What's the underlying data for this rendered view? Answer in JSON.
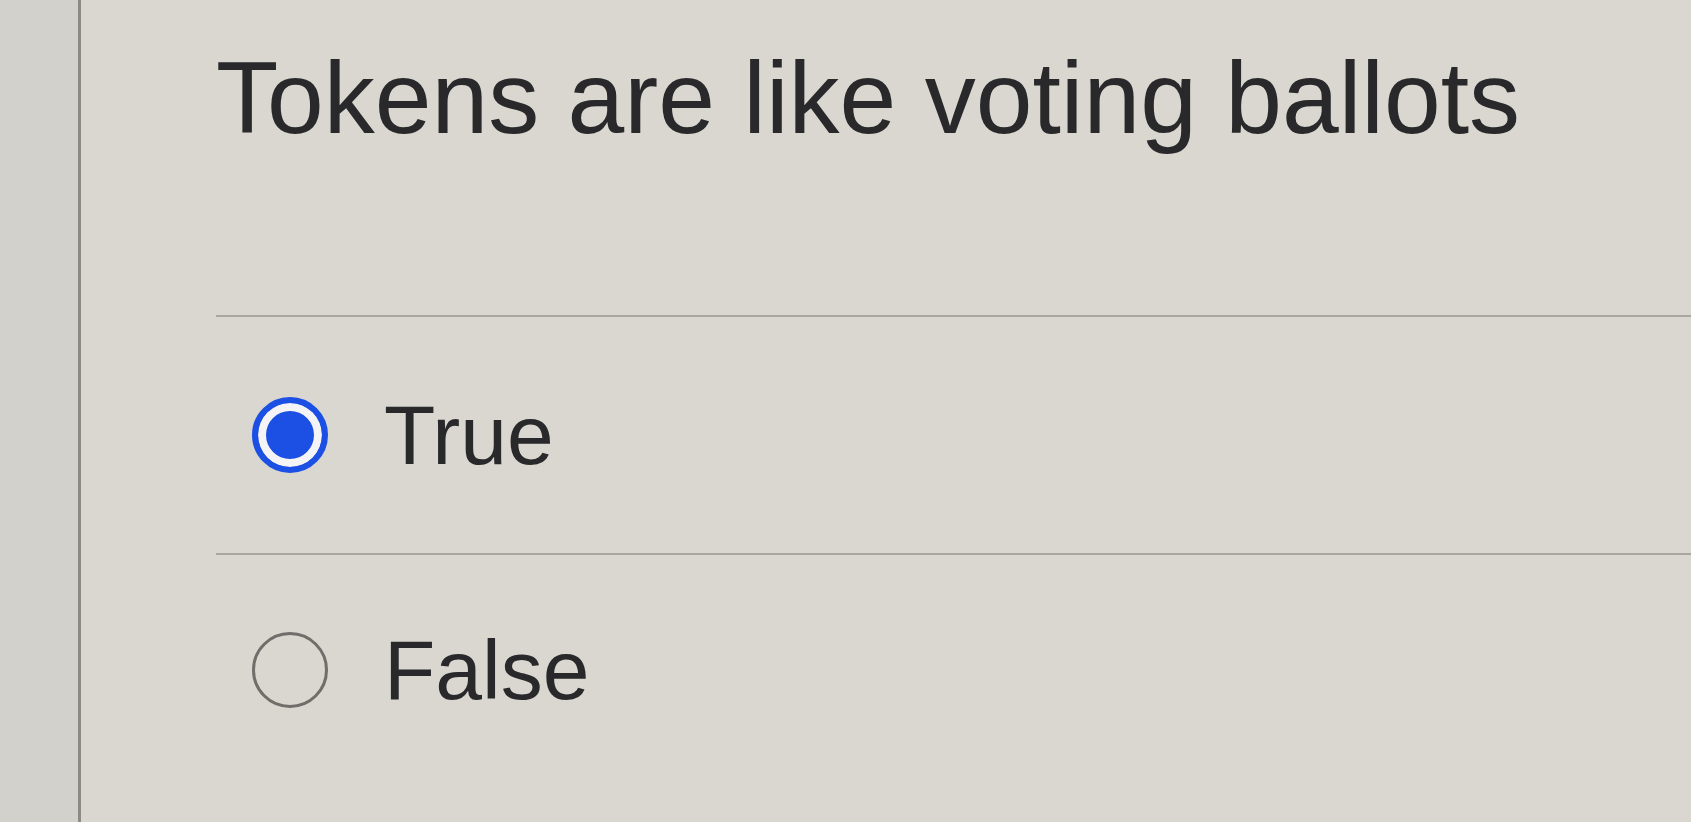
{
  "question": {
    "text": "Tokens are like voting ballots"
  },
  "options": [
    {
      "label": "True",
      "selected": true
    },
    {
      "label": "False",
      "selected": false
    }
  ]
}
